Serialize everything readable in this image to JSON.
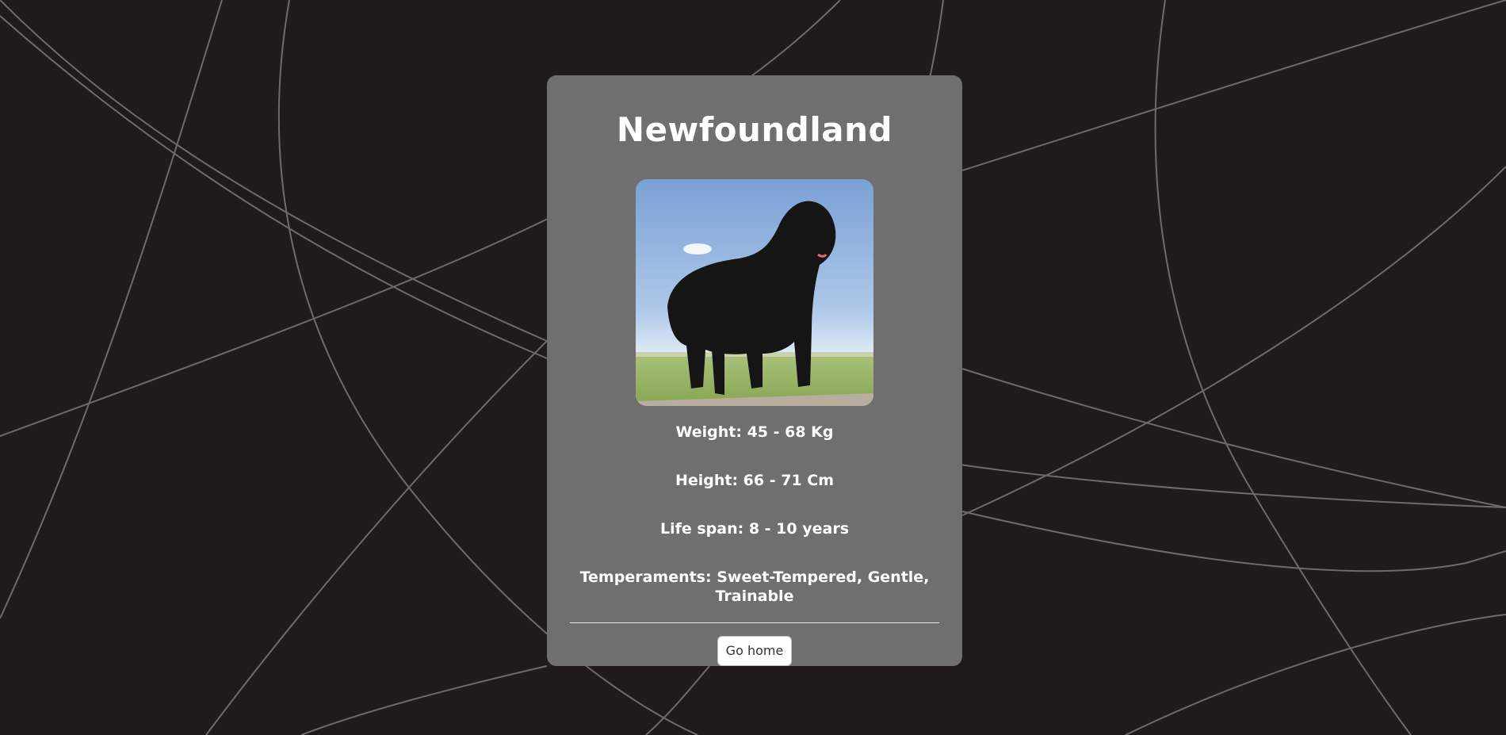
{
  "breed": {
    "name": "Newfoundland",
    "weight": "Weight: 45 - 68 Kg",
    "height": "Height: 66 - 71 Cm",
    "life_span": "Life span: 8 - 10 years",
    "temperaments": "Temperaments: Sweet-Tempered, Gentle, Trainable"
  },
  "actions": {
    "home_label": "Go home"
  },
  "colors": {
    "background": "#201b1b",
    "card": "#6f6f6f",
    "text": "#ffffff"
  }
}
